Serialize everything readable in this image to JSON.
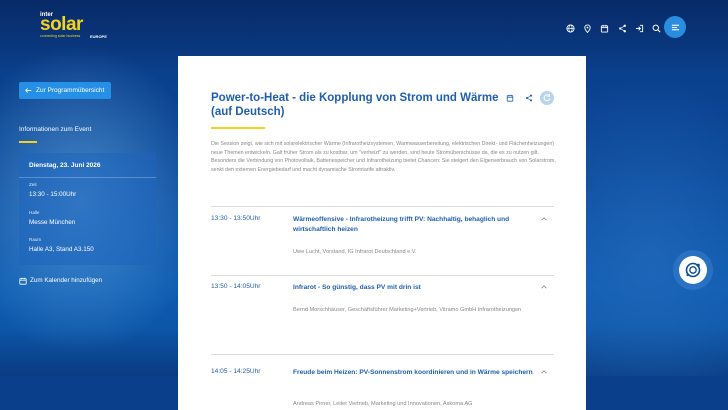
{
  "brand": {
    "inter": "inter",
    "solar": "solar",
    "tagline": "connecting solar business",
    "region": "EUROPE",
    "colors": {
      "accent": "#f6d21d",
      "primary": "#1f5fae",
      "button": "#2690e6"
    }
  },
  "header": {
    "icons": [
      "globe-icon",
      "map-pin-icon",
      "calendar-icon",
      "share-icon",
      "login-icon",
      "search-icon"
    ],
    "menu_icon": "menu-icon"
  },
  "sidebar": {
    "back_label": "Zur Programmübersicht",
    "info_title": "Informationen zum Event",
    "card": {
      "date": "Dienstag, 23. Juni 2026",
      "time_label": "Zeit",
      "time_value": "13:30 - 15:00Uhr",
      "hall_label": "Halle",
      "hall_value": "Messe München",
      "room_label": "Raum",
      "room_value": "Halle A3, Stand A3.150"
    },
    "calendar_label": "Zum Kalender hinzufügen"
  },
  "main": {
    "title": "Power-to-Heat - die Kopplung von Strom und Wärme (auf Deutsch)",
    "description": "Die Session zeigt, wie sich mit solarelektrischer Wärme (Infrarotheizsystemen, Warmwasserbereitung, elektrischen Direkt- und Flächenheizungen) neue Themen entwickeln. Galt früher Strom als zu kostbar, um \"verheizt\" zu werden, sind heute Stromüberschüsse da, die es zu nutzen gilt. Besonders die Verbindung von Photovoltaik, Batteriespeicher und Infrarotheizung bietet Chancen: Sie steigert den Eigenverbrauch von Solarstrom, senkt den externen Energiebedarf und macht dynamische Stromtarife attraktiv.",
    "sessions": [
      {
        "time": "13:30 - 13:50Uhr",
        "title": "Wärmeoffensive - Infrarotheizung trifft PV: Nachhaltig, behaglich und wirtschaftlich heizen",
        "speaker": "Uwe Lucht, Vorstand, IG Infrarot Deutschland e.V."
      },
      {
        "time": "13:50 - 14:05Uhr",
        "title": "Infrarot - So günstig, dass PV mit drin ist",
        "speaker": "Bernd Morschhäuser, Geschäftsführer Marketing+Vertrieb, Vitramo GmbH Infrarotheizungen"
      },
      {
        "time": "14:05 - 14:25Uhr",
        "title": "Freude beim Heizen: PV-Sonnenstrom koordinieren und in Wärme speichern",
        "speaker": "Andreas Pirner, Leiter Vertrieb, Marketing und Innovationen, Askoma AG"
      }
    ]
  }
}
